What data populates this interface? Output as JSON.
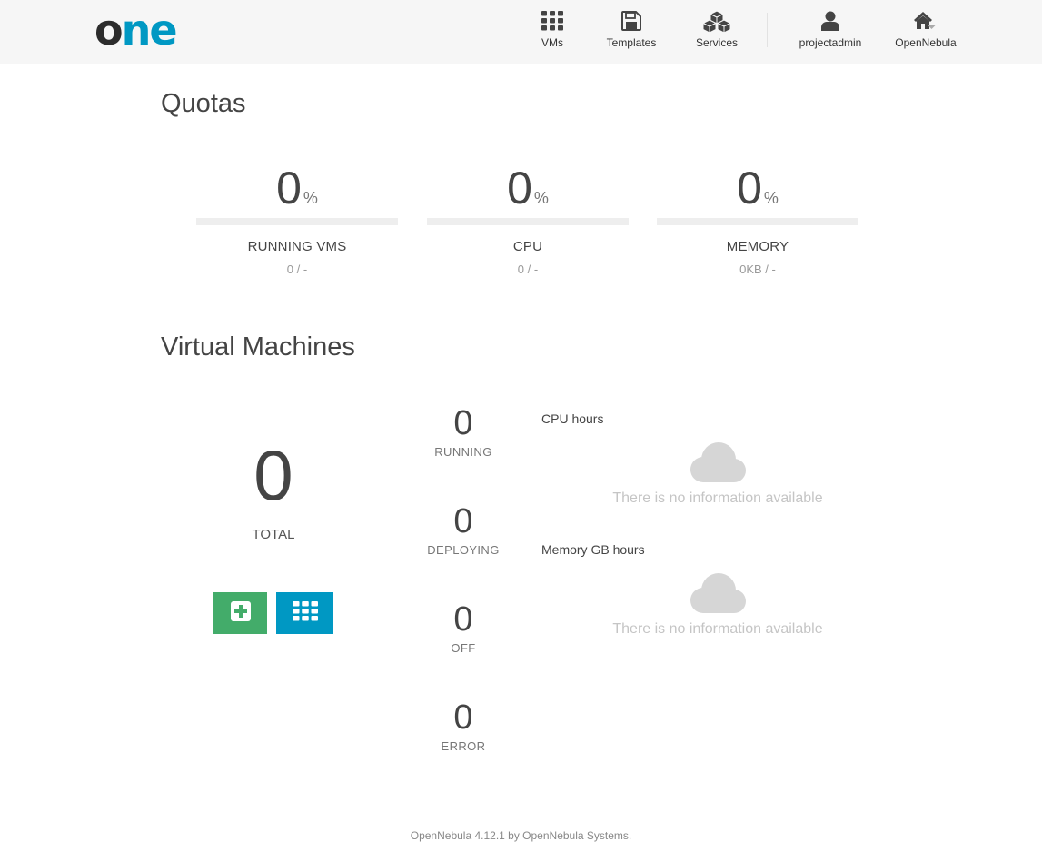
{
  "header": {
    "logo_o": "o",
    "logo_ne": "ne",
    "nav": [
      {
        "label": "VMs",
        "icon": "th-grid-icon"
      },
      {
        "label": "Templates",
        "icon": "floppy-save-icon"
      },
      {
        "label": "Services",
        "icon": "cubes-icon"
      },
      {
        "label": "projectadmin",
        "icon": "user-icon"
      },
      {
        "label": "OpenNebula",
        "icon": "home-icon"
      }
    ],
    "colors": {
      "brand_dark": "#2c2c2c",
      "brand_blue": "#0098c3"
    }
  },
  "quotas": {
    "title": "Quotas",
    "items": [
      {
        "percent": "0",
        "unit": "%",
        "label": "RUNNING VMS",
        "usage": "0 / -",
        "fill": 0
      },
      {
        "percent": "0",
        "unit": "%",
        "label": "CPU",
        "usage": "0 / -",
        "fill": 0
      },
      {
        "percent": "0",
        "unit": "%",
        "label": "MEMORY",
        "usage": "0KB / -",
        "fill": 0
      }
    ]
  },
  "vms": {
    "title": "Virtual Machines",
    "total": "0",
    "total_label": "TOTAL",
    "create_color": "#43ac6a",
    "list_color": "#0098c3",
    "states": [
      {
        "count": "0",
        "label": "RUNNING"
      },
      {
        "count": "0",
        "label": "DEPLOYING"
      },
      {
        "count": "0",
        "label": "OFF"
      },
      {
        "count": "0",
        "label": "ERROR"
      }
    ],
    "charts": [
      {
        "title": "CPU hours",
        "empty_text": "There is no information available"
      },
      {
        "title": "Memory GB hours",
        "empty_text": "There is no information available"
      }
    ]
  },
  "footer": {
    "text": "OpenNebula 4.12.1 by OpenNebula Systems."
  }
}
